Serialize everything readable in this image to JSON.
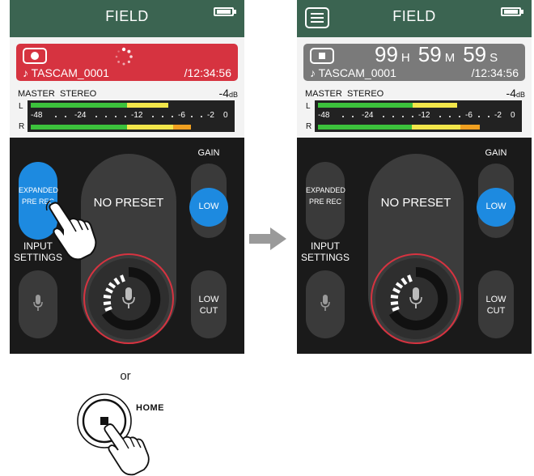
{
  "left_screen": {
    "title": "FIELD",
    "file_name": "♪ TASCAM_0001",
    "total_time": "/12:34:56",
    "meter": {
      "master_label": "MASTER",
      "mode_label": "STEREO",
      "level_value": "-4",
      "level_unit": "dB",
      "ch_left": "L",
      "ch_right": "R",
      "scale_labels": [
        "-48",
        "-24",
        "-12",
        "-6",
        "-2",
        "0"
      ]
    },
    "expanded_prerec_line1": "EXPANDED",
    "expanded_prerec_line2": "PRE REC",
    "preset_label": "NO PRESET",
    "gain_label": "GAIN",
    "gain_value": "LOW",
    "input_settings_line1": "INPUT",
    "input_settings_line2": "SETTINGS",
    "lowcut_line1": "LOW",
    "lowcut_line2": "CUT"
  },
  "right_screen": {
    "title": "FIELD",
    "remaining_hours": "99",
    "hours_unit": "H",
    "remaining_minutes": "59",
    "minutes_unit": "M",
    "remaining_seconds": "59",
    "seconds_unit": "S",
    "file_name": "♪ TASCAM_0001",
    "total_time": "/12:34:56",
    "meter": {
      "master_label": "MASTER",
      "mode_label": "STEREO",
      "level_value": "-4",
      "level_unit": "dB",
      "ch_left": "L",
      "ch_right": "R",
      "scale_labels": [
        "-48",
        "-24",
        "-12",
        "-6",
        "-2",
        "0"
      ]
    },
    "expanded_prerec_line1": "EXPANDED",
    "expanded_prerec_line2": "PRE REC",
    "preset_label": "NO PRESET",
    "gain_label": "GAIN",
    "gain_value": "LOW",
    "input_settings_line1": "INPUT",
    "input_settings_line2": "SETTINGS",
    "lowcut_line1": "LOW",
    "lowcut_line2": "CUT"
  },
  "or_text": "or",
  "home_button_label": "HOME",
  "colors": {
    "title_bar": "#3b6451",
    "rec_active": "#d63340",
    "rec_idle": "#7a7a7a",
    "accent_blue": "#1d8ae0",
    "meter_green": "#3cc23c",
    "meter_yellow": "#f2e64a",
    "meter_orange": "#f0a020",
    "ring_red": "#d63340"
  },
  "icons": [
    "record-icon",
    "stop-icon",
    "menu-icon",
    "battery-icon",
    "microphone-icon",
    "loading-spinner-icon",
    "right-arrow-icon",
    "tap-hand-icon"
  ]
}
